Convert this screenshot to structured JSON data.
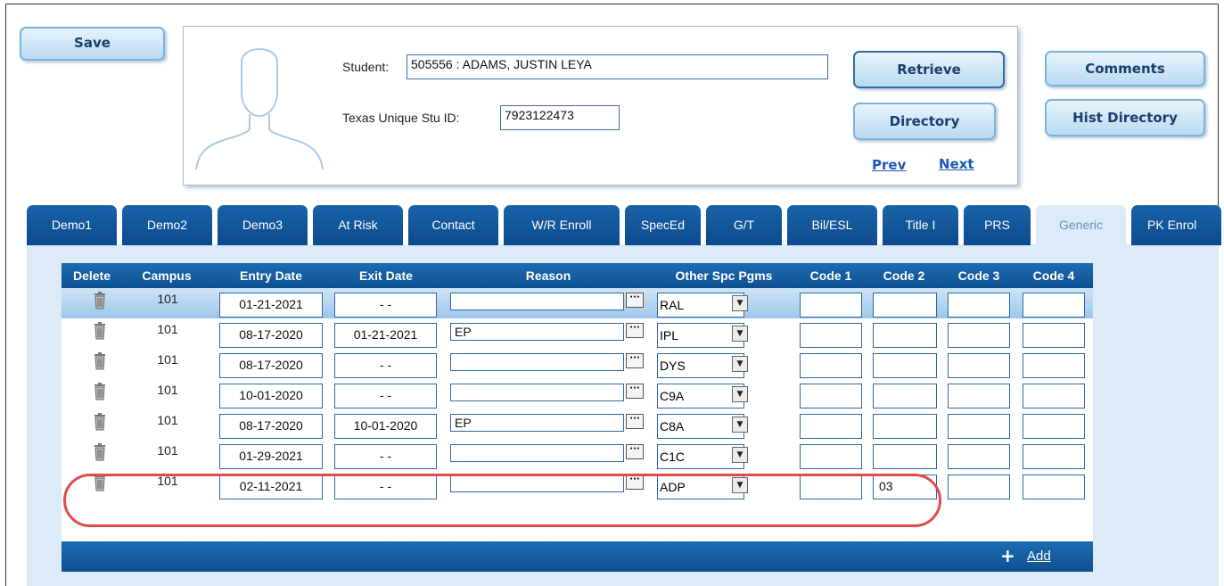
{
  "toolbar": {
    "save": "Save",
    "retrieve": "Retrieve",
    "directory": "Directory",
    "comments": "Comments",
    "hist_directory": "Hist Directory",
    "prev": "Prev",
    "next": "Next"
  },
  "student": {
    "student_label": "Student:",
    "student_value": "505556 : ADAMS, JUSTIN LEYA",
    "tsid_label": "Texas Unique Stu ID:",
    "tsid_value": "7923122473"
  },
  "tabs": [
    "Demo1",
    "Demo2",
    "Demo3",
    "At Risk",
    "Contact",
    "W/R Enroll",
    "SpecEd",
    "G/T",
    "Bil/ESL",
    "Title I",
    "PRS",
    "Generic",
    "PK Enrol"
  ],
  "active_tab": "Generic",
  "grid": {
    "columns": [
      "Delete",
      "Campus",
      "Entry Date",
      "Exit Date",
      "Reason",
      "Other Spc Pgms",
      "Code 1",
      "Code 2",
      "Code 3",
      "Code 4"
    ],
    "rows": [
      {
        "campus": "101",
        "entry": "01-21-2021",
        "exit": "- -",
        "reason": "",
        "pgm": "RAL",
        "code1": "",
        "code2": "",
        "code3": "",
        "code4": ""
      },
      {
        "campus": "101",
        "entry": "08-17-2020",
        "exit": "01-21-2021",
        "reason": "EP",
        "pgm": "IPL",
        "code1": "",
        "code2": "",
        "code3": "",
        "code4": ""
      },
      {
        "campus": "101",
        "entry": "08-17-2020",
        "exit": "- -",
        "reason": "",
        "pgm": "DYS",
        "code1": "",
        "code2": "",
        "code3": "",
        "code4": ""
      },
      {
        "campus": "101",
        "entry": "10-01-2020",
        "exit": "- -",
        "reason": "",
        "pgm": "C9A",
        "code1": "",
        "code2": "",
        "code3": "",
        "code4": ""
      },
      {
        "campus": "101",
        "entry": "08-17-2020",
        "exit": "10-01-2020",
        "reason": "EP",
        "pgm": "C8A",
        "code1": "",
        "code2": "",
        "code3": "",
        "code4": ""
      },
      {
        "campus": "101",
        "entry": "01-29-2021",
        "exit": "- -",
        "reason": "",
        "pgm": "C1C",
        "code1": "",
        "code2": "",
        "code3": "",
        "code4": ""
      },
      {
        "campus": "101",
        "entry": "02-11-2021",
        "exit": "- -",
        "reason": "",
        "pgm": "ADP",
        "code1": "",
        "code2": "03",
        "code3": "",
        "code4": ""
      }
    ],
    "add_symbol": "+",
    "add_label": "Add"
  },
  "ellipsis_glyph": "···",
  "dropdown_glyph": "▼",
  "colors": {
    "tab_blue": "#0c4a8d",
    "panel_bg": "#dcebf7",
    "highlight": "#e34a4a"
  }
}
